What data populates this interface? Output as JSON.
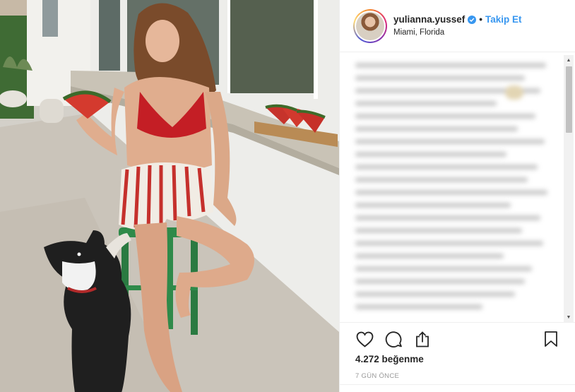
{
  "post": {
    "username": "yulianna.yussef",
    "separator": "•",
    "follow_label": "Takip Et",
    "location": "Miami, Florida",
    "likes_text": "4.272 beğenme",
    "timestamp": "7 GÜN ÖNCE"
  },
  "icons": {
    "like": "heart-icon",
    "comment": "comment-icon",
    "share": "share-icon",
    "save": "bookmark-icon",
    "verified": "verified-badge-icon"
  },
  "colors": {
    "accent": "#3897f0",
    "text": "#262626",
    "muted": "#999999",
    "border": "#efefef"
  }
}
